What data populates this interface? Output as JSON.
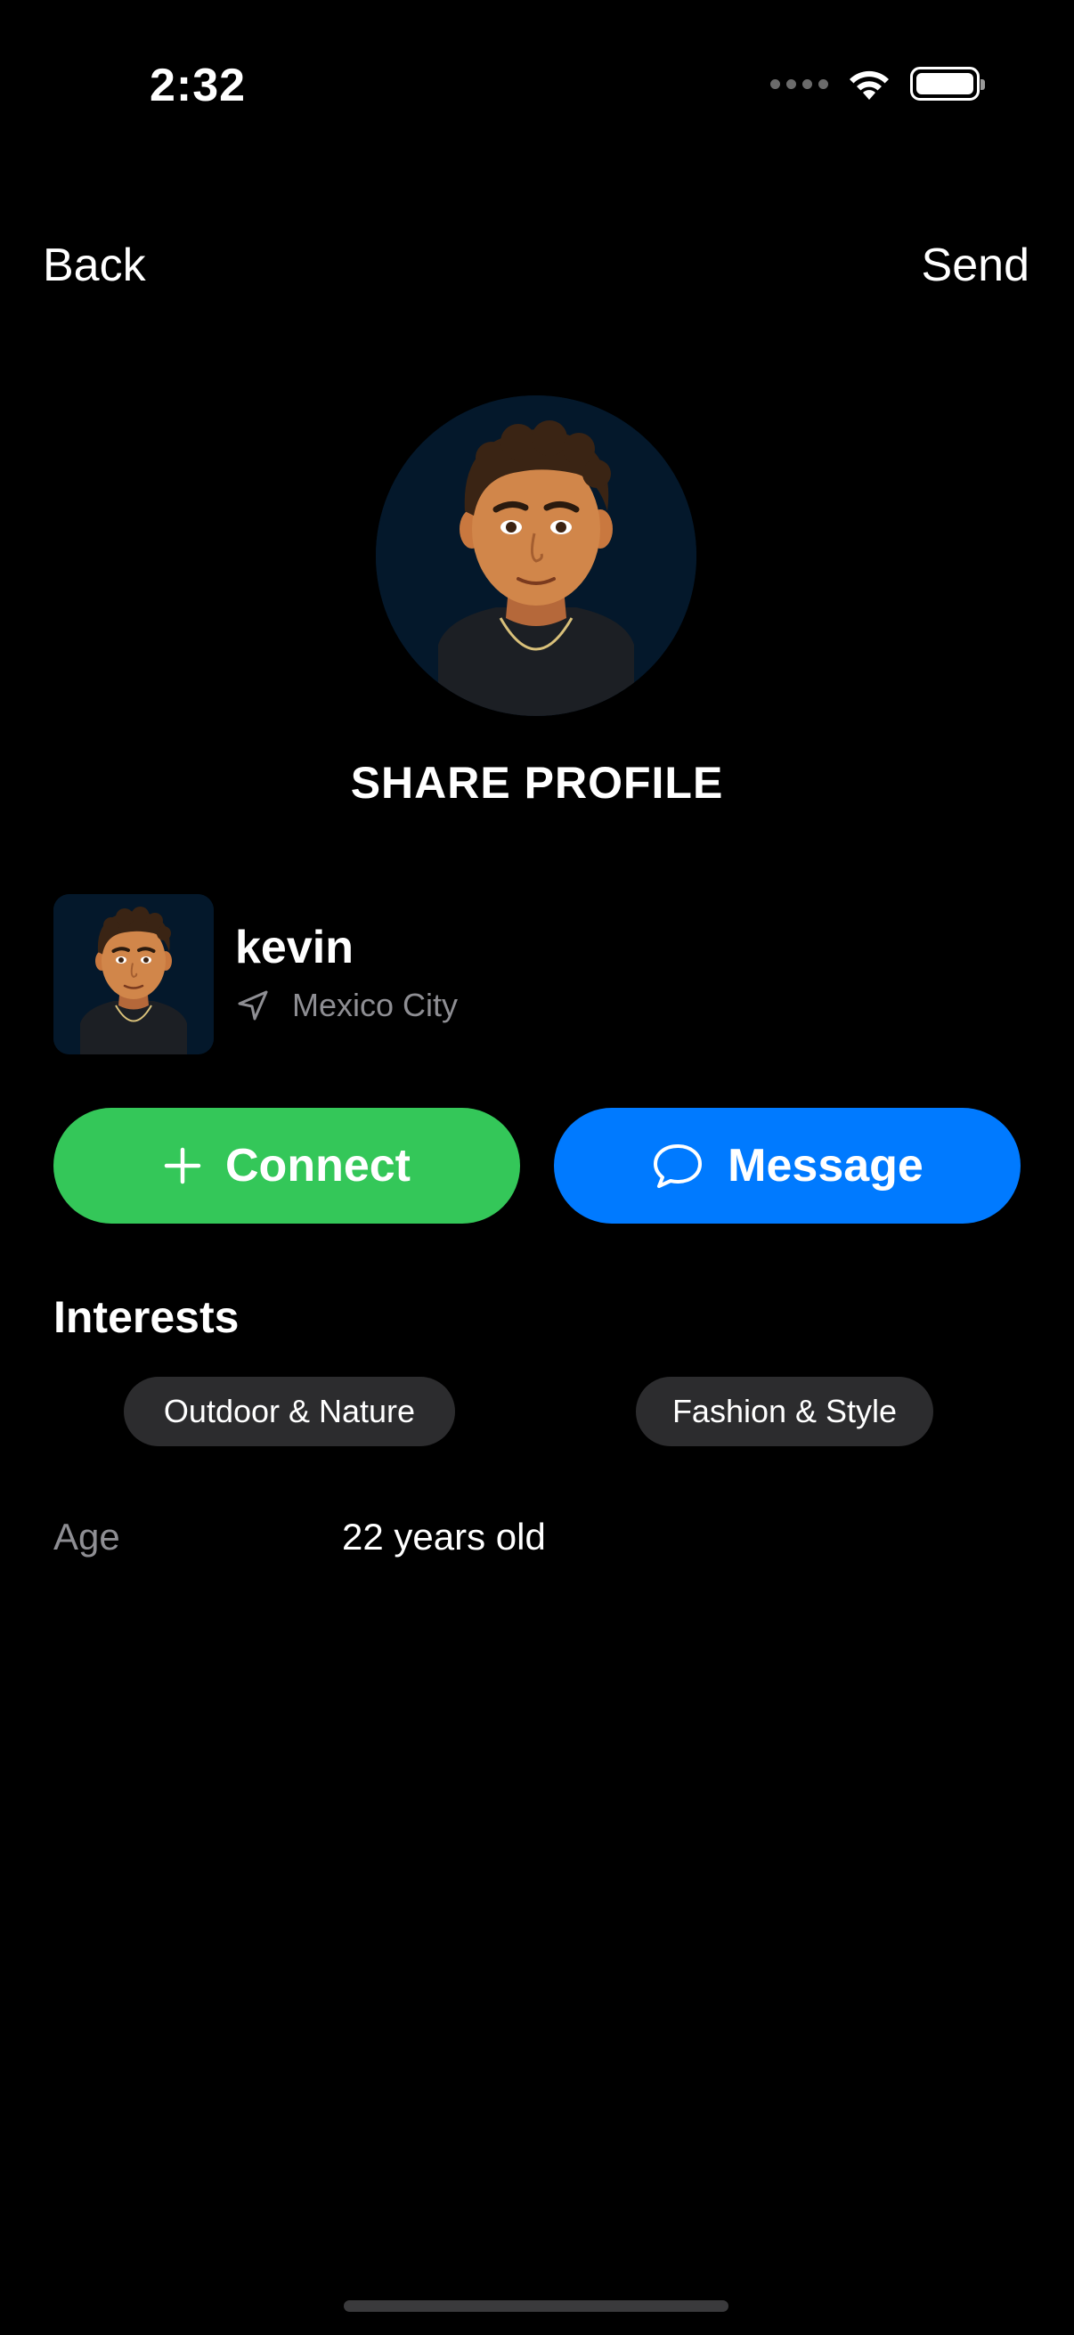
{
  "status_bar": {
    "time": "2:32",
    "icons": [
      "cellular-signal-icon",
      "wifi-icon",
      "battery-icon"
    ]
  },
  "nav": {
    "back_label": "Back",
    "send_label": "Send"
  },
  "profile_header": {
    "avatar": "avatar-illustration",
    "title": "SHARE PROFILE"
  },
  "profile": {
    "name": "kevin",
    "location_icon": "location-arrow-icon",
    "location": "Mexico City"
  },
  "actions": {
    "connect_label": "Connect",
    "connect_icon": "plus-icon",
    "message_label": "Message",
    "message_icon": "chat-bubble-icon"
  },
  "interests": {
    "title": "Interests",
    "items": [
      "Outdoor & Nature",
      "Fashion & Style"
    ]
  },
  "details": {
    "age_label": "Age",
    "age_value": "22 years old"
  },
  "colors": {
    "background": "#000000",
    "connect": "#34c759",
    "message": "#007aff",
    "chip": "#2c2c2e",
    "secondary_text": "#8e8e93"
  }
}
